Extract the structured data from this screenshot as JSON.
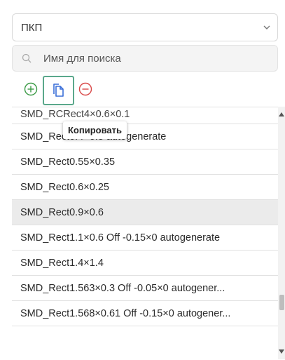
{
  "dropdown": {
    "value": "ПКП",
    "icon": "chevron-down-icon"
  },
  "search": {
    "placeholder": "Имя для поиска",
    "value": "",
    "icon": "search-icon"
  },
  "toolbar": {
    "add_icon": "plus-circle-icon",
    "copy_icon": "copy-icon",
    "remove_icon": "minus-circle-icon",
    "add_color": "#3a9a45",
    "copy_color": "#3b6fd8",
    "remove_color": "#d94848"
  },
  "tooltip": {
    "text": "Копировать"
  },
  "list": {
    "items": [
      "SMD_RCRect4×0.6×0.1",
      "SMD_Rect0.4×0.5 autogenerate",
      "SMD_Rect0.55×0.35",
      "SMD_Rect0.6×0.25",
      "SMD_Rect0.9×0.6",
      "SMD_Rect1.1×0.6 Off -0.15×0 autogenerate",
      "SMD_Rect1.4×1.4",
      "SMD_Rect1.563×0.3 Off -0.05×0 autogener...",
      "SMD_Rect1.568×0.61 Off -0.15×0 autogener..."
    ],
    "selected_index": 4
  }
}
